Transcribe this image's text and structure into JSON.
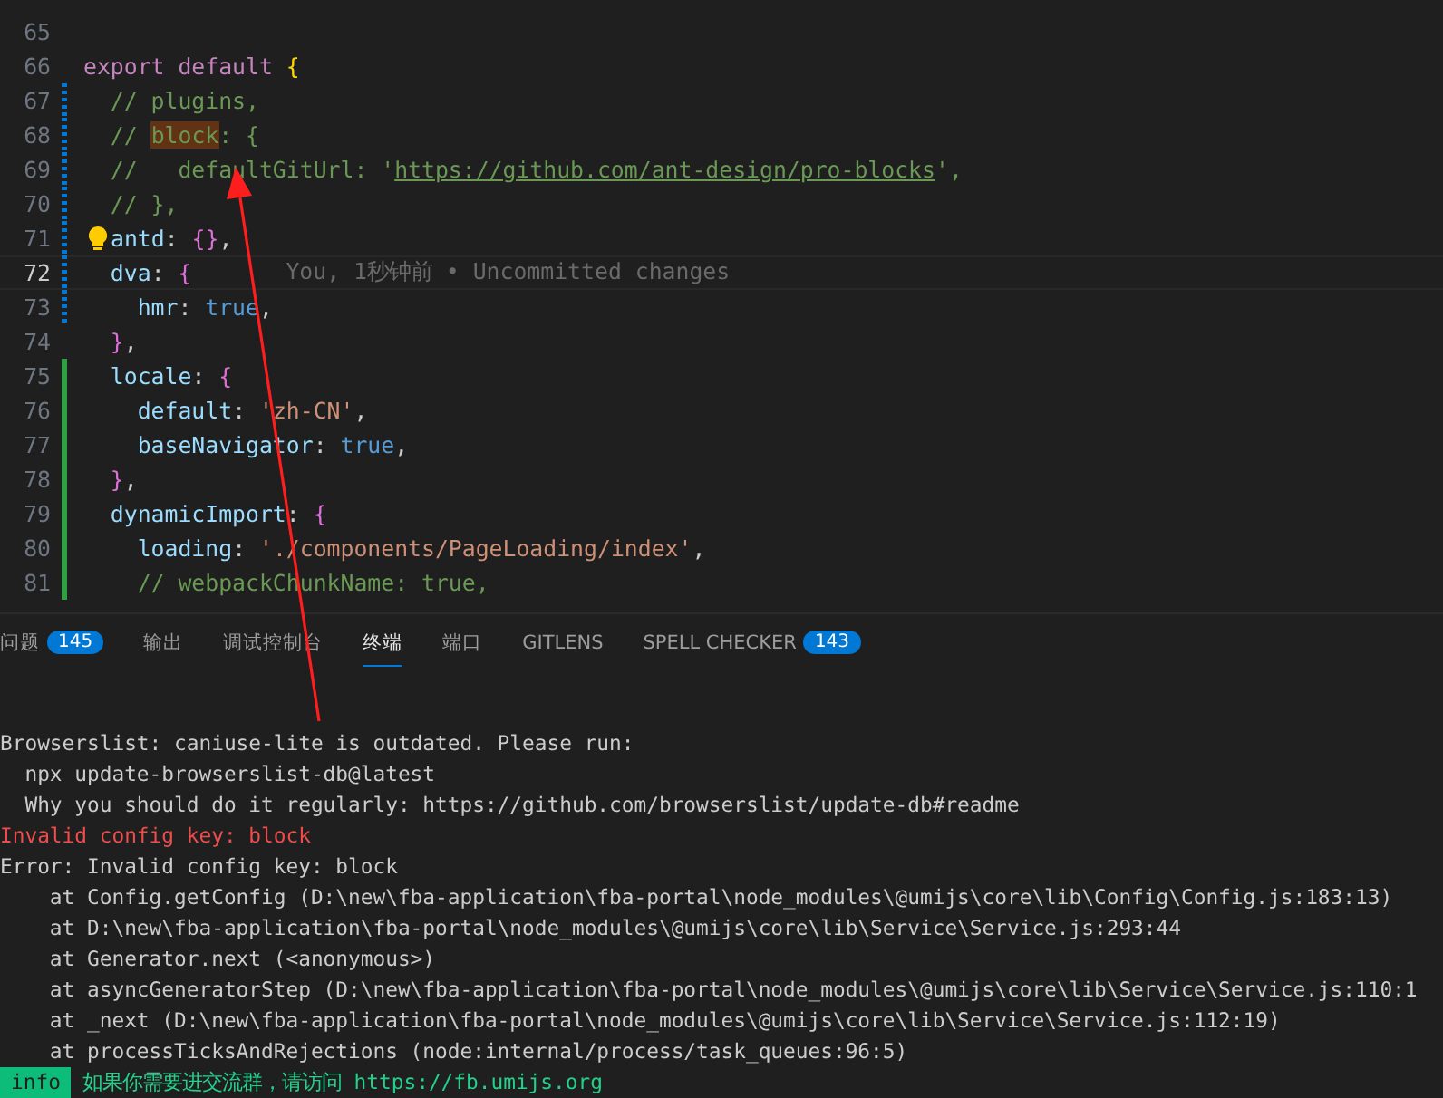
{
  "editor": {
    "lines": [
      {
        "number": "65",
        "current": false,
        "modified": false,
        "added": false,
        "lightbulb": false
      },
      {
        "number": "66",
        "current": false,
        "modified": false,
        "added": false,
        "lightbulb": false,
        "tokens": [
          {
            "kind": "keyword",
            "text": "export default"
          },
          {
            "kind": "brace1",
            "text": " {"
          }
        ]
      },
      {
        "number": "67",
        "current": false,
        "modified": true,
        "added": false,
        "lightbulb": false,
        "tokens": [
          {
            "kind": "comment",
            "text": "  // plugins,"
          }
        ]
      },
      {
        "number": "68",
        "current": false,
        "modified": true,
        "added": false,
        "lightbulb": false,
        "tokens": [
          {
            "kind": "comment",
            "text": "  // "
          },
          {
            "kind": "match",
            "text": "block"
          },
          {
            "kind": "comment",
            "text": ": {"
          }
        ]
      },
      {
        "number": "69",
        "current": false,
        "modified": true,
        "added": false,
        "lightbulb": false,
        "tokens": [
          {
            "kind": "comment",
            "text": "  //   defaultGitUrl: '"
          },
          {
            "kind": "link",
            "text": "https://github.com/ant-design/pro-blocks"
          },
          {
            "kind": "comment",
            "text": "',"
          }
        ]
      },
      {
        "number": "70",
        "current": false,
        "modified": true,
        "added": false,
        "lightbulb": false,
        "tokens": [
          {
            "kind": "comment",
            "text": "  // },"
          }
        ]
      },
      {
        "number": "71",
        "current": false,
        "modified": true,
        "added": false,
        "lightbulb": true,
        "tokens": [
          {
            "kind": "prop",
            "text": "antd"
          },
          {
            "kind": "punct",
            "text": ": "
          },
          {
            "kind": "brace2",
            "text": "{}"
          },
          {
            "kind": "punct",
            "text": ","
          }
        ]
      },
      {
        "number": "72",
        "current": true,
        "modified": true,
        "added": false,
        "lightbulb": false,
        "tokens": [
          {
            "kind": "prop",
            "text": "  dva"
          },
          {
            "kind": "punct",
            "text": ": "
          },
          {
            "kind": "brace2",
            "text": "{"
          }
        ],
        "blame": "You, 1秒钟前 • Uncommitted changes"
      },
      {
        "number": "73",
        "current": false,
        "modified": true,
        "added": false,
        "lightbulb": false,
        "tokens": [
          {
            "kind": "prop",
            "text": "    hmr"
          },
          {
            "kind": "punct",
            "text": ": "
          },
          {
            "kind": "bool",
            "text": "true"
          },
          {
            "kind": "punct",
            "text": ","
          }
        ]
      },
      {
        "number": "74",
        "current": false,
        "modified": false,
        "added": false,
        "lightbulb": false,
        "tokens": [
          {
            "kind": "brace2",
            "text": "  }"
          },
          {
            "kind": "punct",
            "text": ","
          }
        ]
      },
      {
        "number": "75",
        "current": false,
        "modified": false,
        "added": true,
        "lightbulb": false,
        "tokens": [
          {
            "kind": "prop",
            "text": "  locale"
          },
          {
            "kind": "punct",
            "text": ": "
          },
          {
            "kind": "brace2",
            "text": "{"
          }
        ]
      },
      {
        "number": "76",
        "current": false,
        "modified": false,
        "added": true,
        "lightbulb": false,
        "tokens": [
          {
            "kind": "prop",
            "text": "    default"
          },
          {
            "kind": "punct",
            "text": ": "
          },
          {
            "kind": "string",
            "text": "'zh-CN'"
          },
          {
            "kind": "punct",
            "text": ","
          }
        ]
      },
      {
        "number": "77",
        "current": false,
        "modified": false,
        "added": true,
        "lightbulb": false,
        "tokens": [
          {
            "kind": "prop",
            "text": "    baseNavigator"
          },
          {
            "kind": "punct",
            "text": ": "
          },
          {
            "kind": "bool",
            "text": "true"
          },
          {
            "kind": "punct",
            "text": ","
          }
        ]
      },
      {
        "number": "78",
        "current": false,
        "modified": false,
        "added": true,
        "lightbulb": false,
        "tokens": [
          {
            "kind": "brace2",
            "text": "  }"
          },
          {
            "kind": "punct",
            "text": ","
          }
        ]
      },
      {
        "number": "79",
        "current": false,
        "modified": false,
        "added": true,
        "lightbulb": false,
        "tokens": [
          {
            "kind": "prop",
            "text": "  dynamicImport"
          },
          {
            "kind": "punct",
            "text": ": "
          },
          {
            "kind": "brace2",
            "text": "{"
          }
        ]
      },
      {
        "number": "80",
        "current": false,
        "modified": false,
        "added": true,
        "lightbulb": false,
        "tokens": [
          {
            "kind": "prop",
            "text": "    loading"
          },
          {
            "kind": "punct",
            "text": ": "
          },
          {
            "kind": "string",
            "text": "'./components/PageLoading/index'"
          },
          {
            "kind": "punct",
            "text": ","
          }
        ]
      },
      {
        "number": "81",
        "current": false,
        "modified": false,
        "added": true,
        "lightbulb": false,
        "tokens": [
          {
            "kind": "comment",
            "text": "    // webpackChunkName: true,"
          }
        ]
      }
    ]
  },
  "panel": {
    "tabs": [
      {
        "label": "问题",
        "badge": "145",
        "selected": false
      },
      {
        "label": "输出",
        "selected": false
      },
      {
        "label": "调试控制台",
        "selected": false
      },
      {
        "label": "终端",
        "selected": true
      },
      {
        "label": "端口",
        "selected": false
      },
      {
        "label": "GITLENS",
        "selected": false
      },
      {
        "label": "SPELL CHECKER",
        "badge": "143",
        "selected": false
      }
    ],
    "terminal": [
      {
        "kind": "normal",
        "text": "Browserslist: caniuse-lite is outdated. Please run:"
      },
      {
        "kind": "normal",
        "text": "  npx update-browserslist-db@latest"
      },
      {
        "kind": "normal",
        "text": "  Why you should do it regularly: https://github.com/browserslist/update-db#readme"
      },
      {
        "kind": "error",
        "text": "Invalid config key: block"
      },
      {
        "kind": "normal",
        "text": "Error: Invalid config key: block"
      },
      {
        "kind": "normal",
        "text": "    at Config.getConfig (D:\\new\\fba-application\\fba-portal\\node_modules\\@umijs\\core\\lib\\Config\\Config.js:183:13)"
      },
      {
        "kind": "normal",
        "text": "    at D:\\new\\fba-application\\fba-portal\\node_modules\\@umijs\\core\\lib\\Service\\Service.js:293:44"
      },
      {
        "kind": "normal",
        "text": "    at Generator.next (<anonymous>)"
      },
      {
        "kind": "normal",
        "text": "    at asyncGeneratorStep (D:\\new\\fba-application\\fba-portal\\node_modules\\@umijs\\core\\lib\\Service\\Service.js:110:1"
      },
      {
        "kind": "normal",
        "text": "    at _next (D:\\new\\fba-application\\fba-portal\\node_modules\\@umijs\\core\\lib\\Service\\Service.js:112:19)"
      },
      {
        "kind": "normal",
        "text": "    at processTicksAndRejections (node:internal/process/task_queues:96:5)"
      },
      {
        "kind": "info",
        "badge": "info",
        "text": "如果你需要进交流群，请访问 https://fb.umijs.org"
      }
    ]
  }
}
